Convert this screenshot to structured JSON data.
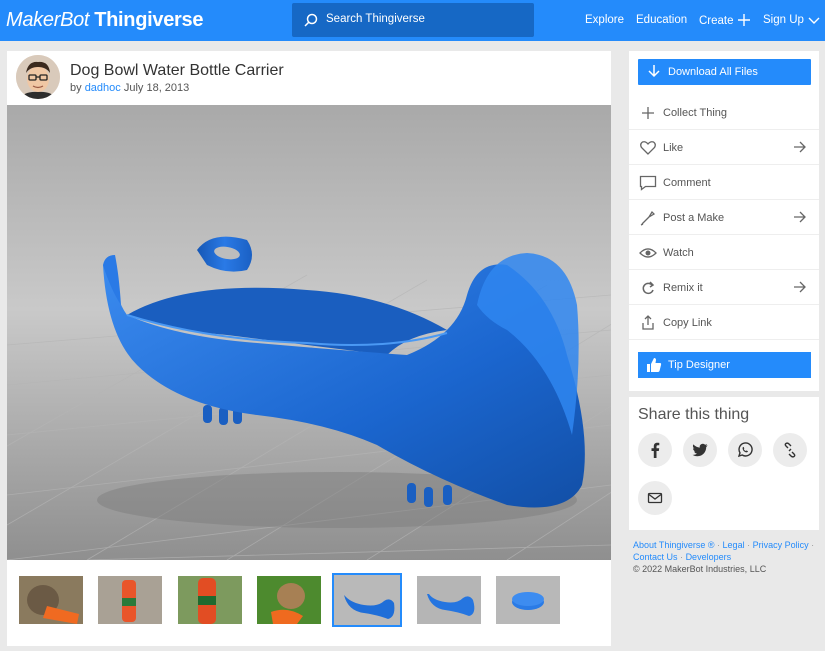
{
  "header": {
    "logo_makerbot": "MakerBot",
    "logo_thingiverse": "Thingiverse",
    "search_placeholder": "Search Thingiverse",
    "nav": [
      "Explore",
      "Education",
      "Create",
      "Sign Up"
    ]
  },
  "thing": {
    "title": "Dog Bowl Water Bottle Carrier",
    "by": "by",
    "author": "dadhoc",
    "date": "July 18, 2013"
  },
  "thumbnails": [
    {
      "name": "photo-dog-drinking"
    },
    {
      "name": "photo-bottle-carrier"
    },
    {
      "name": "photo-bottle-outdoor"
    },
    {
      "name": "photo-dog-grass"
    },
    {
      "name": "render-blue-carrier",
      "active": true
    },
    {
      "name": "render-blue-carrier-side"
    },
    {
      "name": "render-blue-base"
    }
  ],
  "sidebar": {
    "download_label": "Download All Files",
    "actions": [
      {
        "label": "Collect Thing",
        "icon": "plus-icon",
        "arrow": false
      },
      {
        "label": "Like",
        "icon": "heart-icon",
        "arrow": true
      },
      {
        "label": "Comment",
        "icon": "comment-icon",
        "arrow": false
      },
      {
        "label": "Post a Make",
        "icon": "make-icon",
        "arrow": true
      },
      {
        "label": "Watch",
        "icon": "eye-icon",
        "arrow": false
      },
      {
        "label": "Remix it",
        "icon": "remix-icon",
        "arrow": true
      },
      {
        "label": "Copy Link",
        "icon": "share-icon",
        "arrow": false
      }
    ],
    "tip_label": "Tip Designer"
  },
  "share": {
    "title": "Share this thing",
    "buttons": [
      "facebook-icon",
      "twitter-icon",
      "whatsapp-icon",
      "link-icon",
      "email-icon"
    ]
  },
  "footer": {
    "about": "About Thingiverse ®",
    "legal": "Legal",
    "privacy": "Privacy Policy",
    "contact": "Contact Us",
    "developers": "Developers",
    "copyright": "© 2022 MakerBot Industries, LLC"
  },
  "colors": {
    "brand_blue": "#248bfb",
    "model_blue": "#1e6ed8"
  }
}
